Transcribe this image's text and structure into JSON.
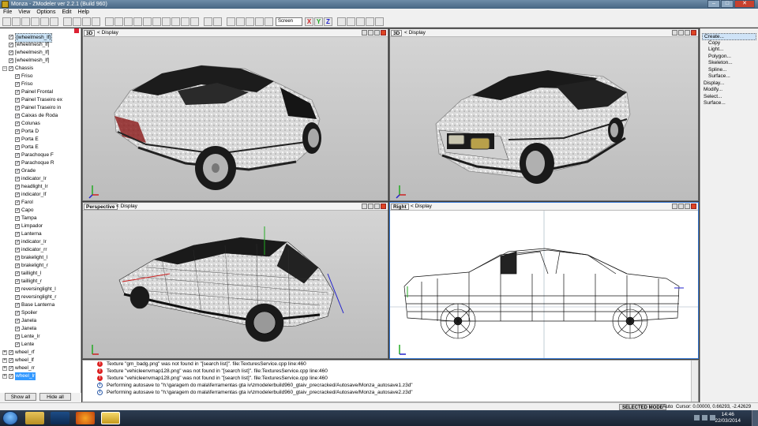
{
  "window": {
    "title": "Monza - ZModeler ver 2.2.1 (Build 960)"
  },
  "menu": [
    "File",
    "View",
    "Options",
    "Edit",
    "Help"
  ],
  "toolbar": {
    "mode_select": "Screen",
    "axes": [
      "X",
      "Y",
      "Z"
    ]
  },
  "tree": {
    "items": [
      {
        "label": "[wheelmesh_lf]",
        "level": 0,
        "type": "check",
        "checked": true,
        "state": "highlight"
      },
      {
        "label": "[wheelmesh_lf]",
        "level": 0,
        "type": "check",
        "checked": true
      },
      {
        "label": "[wheelmesh_lf]",
        "level": 0,
        "type": "check",
        "checked": true
      },
      {
        "label": "[wheelmesh_lf]",
        "level": 0,
        "type": "check",
        "checked": true
      },
      {
        "label": "Chassis",
        "level": 0,
        "type": "expand",
        "expanded": true,
        "checked": true
      },
      {
        "label": "Friso",
        "level": 1,
        "type": "check",
        "checked": true
      },
      {
        "label": "Friso",
        "level": 1,
        "type": "check",
        "checked": true
      },
      {
        "label": "Painel Frontal",
        "level": 1,
        "type": "check",
        "checked": true
      },
      {
        "label": "Painel Traseiro ex",
        "level": 1,
        "type": "check",
        "checked": true
      },
      {
        "label": "Painel Traseiro in",
        "level": 1,
        "type": "check",
        "checked": true
      },
      {
        "label": "Caixas de Roda",
        "level": 1,
        "type": "check",
        "checked": true
      },
      {
        "label": "Colunas",
        "level": 1,
        "type": "check",
        "checked": true
      },
      {
        "label": "Porta D",
        "level": 1,
        "type": "check",
        "checked": true
      },
      {
        "label": "Porta E",
        "level": 1,
        "type": "check",
        "checked": true
      },
      {
        "label": "Porta E",
        "level": 1,
        "type": "check",
        "checked": true
      },
      {
        "label": "Parachoque F",
        "level": 1,
        "type": "check",
        "checked": true
      },
      {
        "label": "Parachoque R",
        "level": 1,
        "type": "check",
        "checked": true
      },
      {
        "label": "Grade",
        "level": 1,
        "type": "check",
        "checked": true
      },
      {
        "label": "indicator_lr",
        "level": 1,
        "type": "check",
        "checked": true
      },
      {
        "label": "headlight_lr",
        "level": 1,
        "type": "check",
        "checked": true
      },
      {
        "label": "indicator_lf",
        "level": 1,
        "type": "check",
        "checked": true
      },
      {
        "label": "Farol",
        "level": 1,
        "type": "check",
        "checked": true
      },
      {
        "label": "Capo",
        "level": 1,
        "type": "check",
        "checked": true
      },
      {
        "label": "Tampa",
        "level": 1,
        "type": "check",
        "checked": true
      },
      {
        "label": "Limpador",
        "level": 1,
        "type": "check",
        "checked": true
      },
      {
        "label": "Lanterna",
        "level": 1,
        "type": "check",
        "checked": true
      },
      {
        "label": "indicator_lr",
        "level": 1,
        "type": "check",
        "checked": true
      },
      {
        "label": "indicator_rr",
        "level": 1,
        "type": "check",
        "checked": true
      },
      {
        "label": "brakelight_l",
        "level": 1,
        "type": "check",
        "checked": true
      },
      {
        "label": "brakelight_r",
        "level": 1,
        "type": "check",
        "checked": true
      },
      {
        "label": "taillight_l",
        "level": 1,
        "type": "check",
        "checked": true
      },
      {
        "label": "taillight_r",
        "level": 1,
        "type": "check",
        "checked": true
      },
      {
        "label": "reversinglight_l",
        "level": 1,
        "type": "check",
        "checked": true
      },
      {
        "label": "reversinglight_r",
        "level": 1,
        "type": "check",
        "checked": true
      },
      {
        "label": "Base Lanterna",
        "level": 1,
        "type": "check",
        "checked": true
      },
      {
        "label": "Spoiler",
        "level": 1,
        "type": "check",
        "checked": true
      },
      {
        "label": "Janela",
        "level": 1,
        "type": "check",
        "checked": true
      },
      {
        "label": "Janela",
        "level": 1,
        "type": "check",
        "checked": true
      },
      {
        "label": "Lente_lr",
        "level": 1,
        "type": "check",
        "checked": true
      },
      {
        "label": "Lente",
        "level": 1,
        "type": "check",
        "checked": true
      },
      {
        "label": "wheel_rf",
        "level": 0,
        "type": "expand",
        "expanded": false,
        "checked": true
      },
      {
        "label": "wheel_lf",
        "level": 0,
        "type": "expand",
        "expanded": false,
        "checked": true
      },
      {
        "label": "wheel_rr",
        "level": 0,
        "type": "expand",
        "expanded": false,
        "checked": true
      },
      {
        "label": "wheel_lr",
        "level": 0,
        "type": "expand",
        "expanded": false,
        "checked": true,
        "state": "selected"
      }
    ],
    "show_all": "Show all",
    "hide_all": "Hide all"
  },
  "viewports": [
    {
      "name": "3D",
      "display": "Display",
      "active": false
    },
    {
      "name": "3D",
      "display": "Display",
      "active": false
    },
    {
      "name": "Perspective",
      "display": "Display",
      "active": false
    },
    {
      "name": "Right",
      "display": "Display",
      "active": true
    }
  ],
  "rightpanel": {
    "items": [
      {
        "label": "Create...",
        "level": 0,
        "highlight": true
      },
      {
        "label": "Copy",
        "level": 1
      },
      {
        "label": "Light...",
        "level": 1
      },
      {
        "label": "Polygon...",
        "level": 1
      },
      {
        "label": "Skeleton...",
        "level": 1
      },
      {
        "label": "Spline...",
        "level": 1
      },
      {
        "label": "Surface...",
        "level": 1
      },
      {
        "label": "Display...",
        "level": 0
      },
      {
        "label": "Modify...",
        "level": 0
      },
      {
        "label": "Select...",
        "level": 0
      },
      {
        "label": "Surface...",
        "level": 0
      }
    ]
  },
  "log": [
    {
      "type": "error",
      "text": "Texture \"gm_badg.png\" was not found in \"[search list]\". file:TexturesService.cpp line:460"
    },
    {
      "type": "error",
      "text": "Texture \"vehicleenvmap128.png\" was not found in \"[search list]\". file:TexturesService.cpp line:460"
    },
    {
      "type": "error",
      "text": "Texture \"vehicleenvmap128.png\" was not found in \"[search list]\". file:TexturesService.cpp line:460"
    },
    {
      "type": "info",
      "text": "Performing autosave to \"h:\\garagem do mala\\ferramentas gta iv\\zmodelerbuild960_gtaiv_precracked/Autosave/Monza_autosave1.z3d\""
    },
    {
      "type": "info",
      "text": "Performing autosave to \"h:\\garagem do mala\\ferramentas gta iv\\zmodelerbuild960_gtaiv_precracked/Autosave/Monza_autosave2.z3d\""
    }
  ],
  "status": {
    "mode": "SELECTED MODE",
    "auto": "Auto",
    "cursor": "Cursor: 0.00000, 0.66293, -2.42629"
  },
  "taskbar": {
    "time": "14:46",
    "date": "22/03/2014"
  }
}
